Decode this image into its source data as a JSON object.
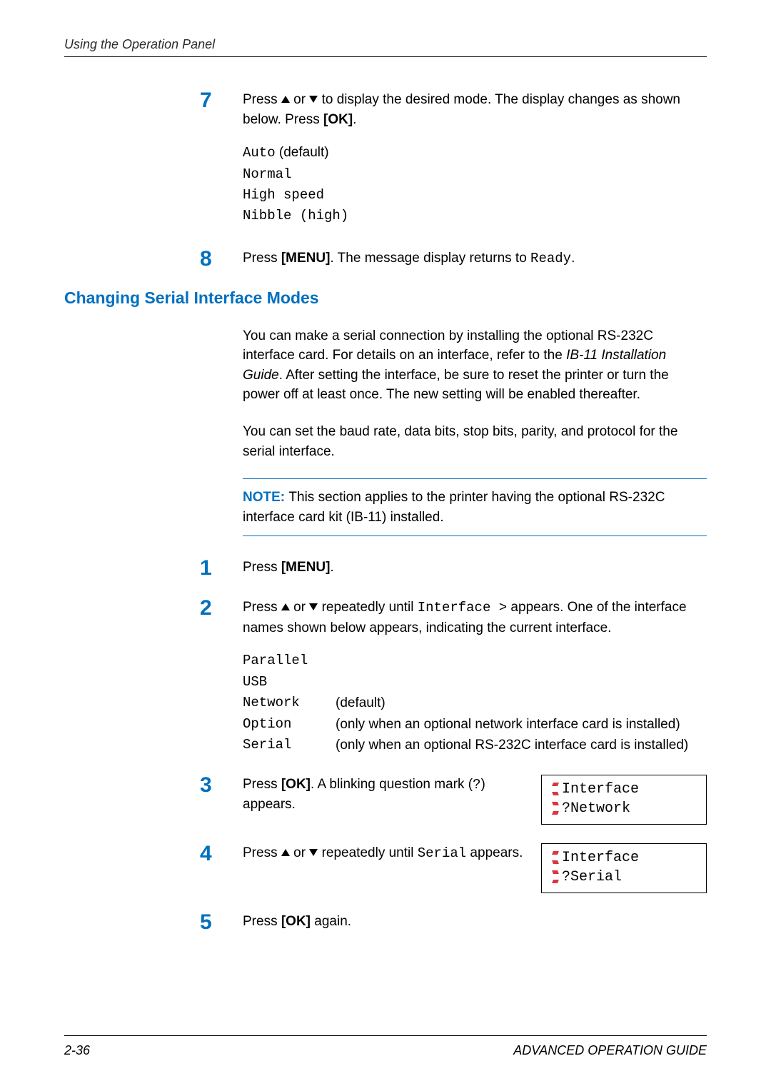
{
  "header": {
    "running": "Using the Operation Panel"
  },
  "step7": {
    "num": "7",
    "text_a": "Press ",
    "text_b": " or ",
    "text_c": " to display the desired mode. The display changes as shown below. Press ",
    "ok": "[OK]",
    "text_d": ".",
    "modes": {
      "l1a": "Auto",
      "l1b": " (default)",
      "l2": "Normal",
      "l3": "High speed",
      "l4": "Nibble (high)"
    }
  },
  "step8": {
    "num": "8",
    "a": "Press ",
    "menu": "[MENU]",
    "b": ". The message display returns to ",
    "ready": "Ready",
    "c": "."
  },
  "section": {
    "title": "Changing Serial Interface Modes"
  },
  "p1": {
    "a": "You can make a serial connection by installing the optional RS-232C interface card. For details on an interface, refer to the ",
    "i": "IB-11 Installation Guide",
    "b": ". After setting the interface, be sure to reset the printer or turn the power off at least once. The new setting will be enabled thereafter."
  },
  "p2": "You can set the baud rate, data bits, stop bits, parity, and protocol for the serial interface.",
  "note": {
    "label": "NOTE: ",
    "text": "This section applies to the printer having the optional RS-232C interface card kit (IB-11) installed."
  },
  "s1": {
    "num": "1",
    "a": "Press ",
    "menu": "[MENU]",
    "b": "."
  },
  "s2": {
    "num": "2",
    "a": "Press ",
    "b": " or ",
    "c": " repeatedly until ",
    "iface": "Interface >",
    "d": " appears. One of the interface names shown below appears, indicating the current interface.",
    "rows": {
      "r1": "Parallel",
      "r2": "USB",
      "r3k": "Network",
      "r3v": "(default)",
      "r4k": "Option",
      "r4v": "(only when an optional network interface card is installed)",
      "r5k": "Serial",
      "r5v": "(only when an optional RS-232C interface card is installed)"
    }
  },
  "s3": {
    "num": "3",
    "a": "Press ",
    "ok": "[OK]",
    "b": ". A blinking question mark (",
    "q": "?",
    "c": ") appears.",
    "lcd": {
      "l1": "Interface",
      "l2": "?Network"
    }
  },
  "s4": {
    "num": "4",
    "a": "Press ",
    "b": " or ",
    "c": " repeatedly until ",
    "serial": "Serial",
    "d": " appears.",
    "lcd": {
      "l1": "Interface",
      "l2": "?Serial"
    }
  },
  "s5": {
    "num": "5",
    "a": "Press ",
    "ok": "[OK]",
    "b": " again."
  },
  "footer": {
    "page": "2-36",
    "guide": "ADVANCED OPERATION GUIDE"
  }
}
